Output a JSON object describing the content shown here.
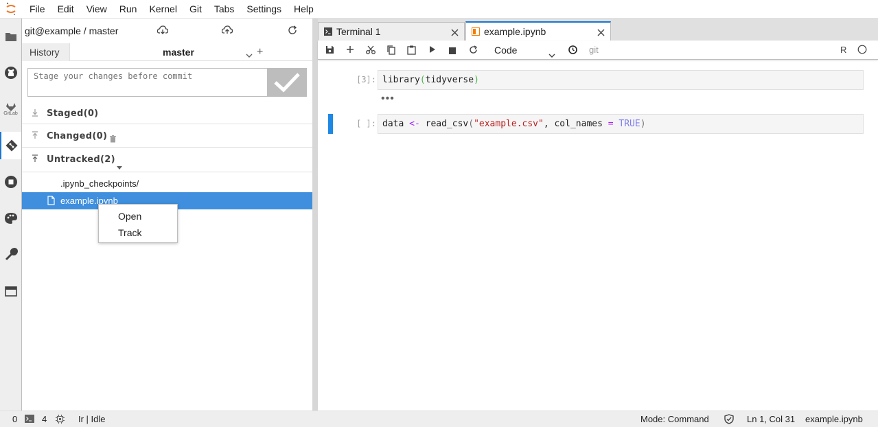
{
  "menu": [
    "File",
    "Edit",
    "View",
    "Run",
    "Kernel",
    "Git",
    "Tabs",
    "Settings",
    "Help"
  ],
  "activity_bar": {
    "icons": [
      "folder-icon",
      "github-icon",
      "gitlab-icon",
      "git-icon",
      "running-icon",
      "palette-icon",
      "wrench-icon",
      "tabs-icon"
    ],
    "gitlab_label": "GitLab"
  },
  "git_panel": {
    "repo": "git@example / master",
    "history_tab": "History",
    "branch": "master",
    "commit_placeholder": "Stage your changes before commit",
    "sections": {
      "staged": "Staged(0)",
      "changed": "Changed(0)",
      "untracked": "Untracked(2)"
    },
    "untracked_files": [
      ".ipynb_checkpoints/",
      "example.ipynb"
    ],
    "selected_file": "example.ipynb"
  },
  "context_menu": {
    "items": [
      "Open",
      "Track"
    ]
  },
  "tabs": {
    "terminal": "Terminal 1",
    "notebook": "example.ipynb"
  },
  "notebook_toolbar": {
    "cell_type": "Code",
    "git_label": "git",
    "kernel": "R"
  },
  "cells": [
    {
      "prompt": "[3]:",
      "code": "library(tidyverse)"
    },
    {
      "prompt": "[ ]:",
      "code": "data <- read_csv(\"example.csv\", col_names = TRUE)"
    }
  ],
  "status_bar": {
    "count_a": "0",
    "count_b": "4",
    "kernel_status": "Ir | Idle",
    "mode": "Mode: Command",
    "cursor": "Ln 1, Col 31",
    "filename": "example.ipynb"
  },
  "colors": {
    "accent": "#1976d2",
    "selection": "#3f8fde",
    "active_cell": "#1e88e5"
  }
}
